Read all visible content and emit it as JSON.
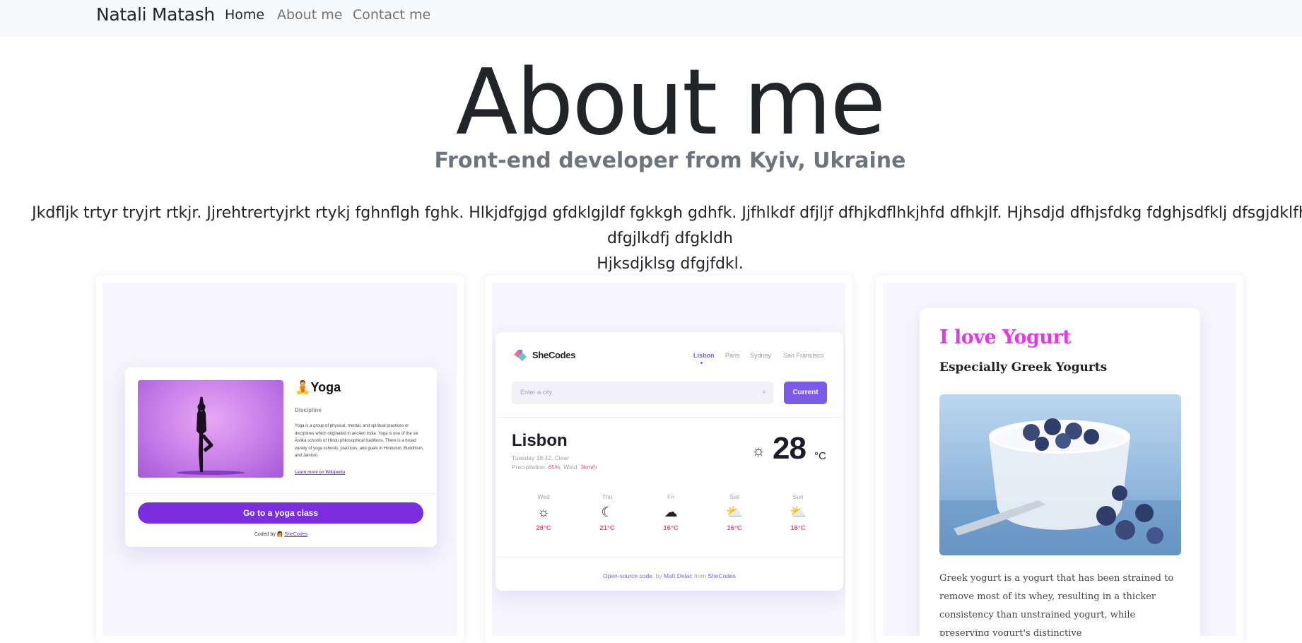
{
  "nav": {
    "brand": "Natali Matash",
    "links": [
      "Home",
      "About me",
      "Contact me"
    ]
  },
  "hero": {
    "title": "About me",
    "subtitle": "Front-end developer from Kyiv, Ukraine",
    "bio": "Jkdfljk trtyr tryjrt rtkjr. Jjrehtrertyjrkt rtykj fghnflgh fghk. Hlkjdfgjgd gfdklgjldf fgkkgh gdhfk. Jjfhlkdf dfjljf dfhjkdflhkjhfd dfhkjlf. Hjhsdjd dfhjsfdkg fdghjsdfklj dfsgjdklfh dfgjlkdfj dfgkldh\nHjksdjklsg dfgjfdkl."
  },
  "projects": {
    "yoga": {
      "title": "Yoga",
      "emoji": "🧘",
      "discipline_label": "Discipline",
      "description": "Yoga is a group of physical, mental, and spiritual practices or disciplines which originated in ancient India. Yoga is one of the six Āstika schools of Hindu philosophical traditions. There is a broad variety of yoga schools, practices, and goals in Hinduism, Buddhism, and Jainism.",
      "link": "Learn more on Wikipedia",
      "button": "Go to a yoga class",
      "coded_by": "Coded by 👩 ",
      "coded_link": "SheCodes"
    },
    "weather": {
      "brand": "SheCodes",
      "cities": [
        "Lisbon",
        "Paris",
        "Sydney",
        "San Francisco"
      ],
      "search_placeholder": "Enter a city",
      "current_button": "Current",
      "city": "Lisbon",
      "meta_line1": "Tuesday 18:42, Clear",
      "precip_label": "Precipitation: ",
      "precip_value": "65%",
      "wind_label": ", Wind: ",
      "wind_value": "3km/h",
      "temperature": "28",
      "unit": "°C",
      "forecast": [
        {
          "day": "Wed",
          "icon": "☼",
          "temp": "28°C"
        },
        {
          "day": "Thu",
          "icon": "☾",
          "temp": "21°C"
        },
        {
          "day": "Fri",
          "icon": "☁",
          "temp": "16°C"
        },
        {
          "day": "Sat",
          "icon": "⛅",
          "temp": "16°C"
        },
        {
          "day": "Sun",
          "icon": "⛅",
          "temp": "16°C"
        }
      ],
      "footer_link1": "Open-source code",
      "footer_by": ", by ",
      "footer_link2": "Matt Delac",
      "footer_from": " from ",
      "footer_link3": "SheCodes"
    },
    "yogurt": {
      "title": "I love Yogurt",
      "subtitle": "Especially Greek Yogurts",
      "text": "Greek yogurt is a yogurt that has been strained to remove most of its whey, resulting in a thicker consistency than unstrained yogurt, while preserving yogurt's distinctive"
    }
  },
  "colors": {
    "navbar_bg": "#f8f9fa",
    "yoga_accent": "#7a2ee0",
    "weather_accent": "#7b5be8",
    "weather_temp": "#e5547a",
    "yogurt_title": "#e338e6"
  }
}
